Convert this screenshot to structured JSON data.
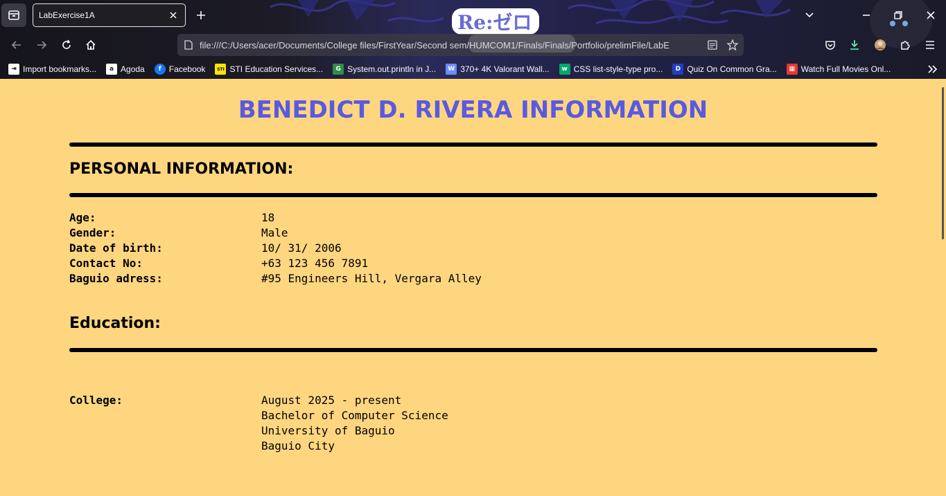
{
  "browser": {
    "tab_title": "LabExercise1A",
    "url": "file:///C:/Users/acer/Documents/College files/FirstYear/Second sem/HUMCOM1/Finals/Finals/Portfolio/prelimFile/LabE",
    "theme_logo_text": "Re:ゼロ",
    "bookmarks": [
      {
        "label": "Import bookmarks...",
        "icon": "import-icon",
        "color": "#ffffff"
      },
      {
        "label": "Agoda",
        "icon": "agoda-icon",
        "color": "#ffffff"
      },
      {
        "label": "Facebook",
        "icon": "facebook-icon",
        "color": "#1877f2"
      },
      {
        "label": "STI Education Services...",
        "icon": "sti-icon",
        "color": "#ffe400"
      },
      {
        "label": "System.out.println in J...",
        "icon": "geeksforgeeks-icon",
        "color": "#2f8d46"
      },
      {
        "label": "370+ 4K Valorant Wall...",
        "icon": "wallpaper-icon",
        "color": "#6a8cff"
      },
      {
        "label": "CSS list-style-type pro...",
        "icon": "w3schools-icon",
        "color": "#04aa6d"
      },
      {
        "label": "Quiz On Common Gra...",
        "icon": "quiz-icon",
        "color": "#2040c0"
      },
      {
        "label": "Watch Full Movies Onl...",
        "icon": "movies-icon",
        "color": "#e53935"
      }
    ]
  },
  "page": {
    "title": "BENEDICT D. RIVERA INFORMATION",
    "title_color": "#5a5ae0",
    "background": "#ffd680",
    "personal": {
      "heading": "PERSONAL INFORMATION:",
      "rows": [
        {
          "key": "Age:",
          "value": "18"
        },
        {
          "key": "Gender:",
          "value": "Male"
        },
        {
          "key": "Date of birth:",
          "value": "10/ 31/ 2006"
        },
        {
          "key": "Contact No:",
          "value": "+63 123 456 7891"
        },
        {
          "key": "Baguio adress:",
          "value": "#95 Engineers Hill, Vergara Alley"
        }
      ]
    },
    "education": {
      "heading": "Education:",
      "college_label": "College:",
      "college_lines": [
        "August 2025 - present",
        "Bachelor of Computer Science",
        "University of Baguio",
        "Baguio City"
      ]
    }
  }
}
